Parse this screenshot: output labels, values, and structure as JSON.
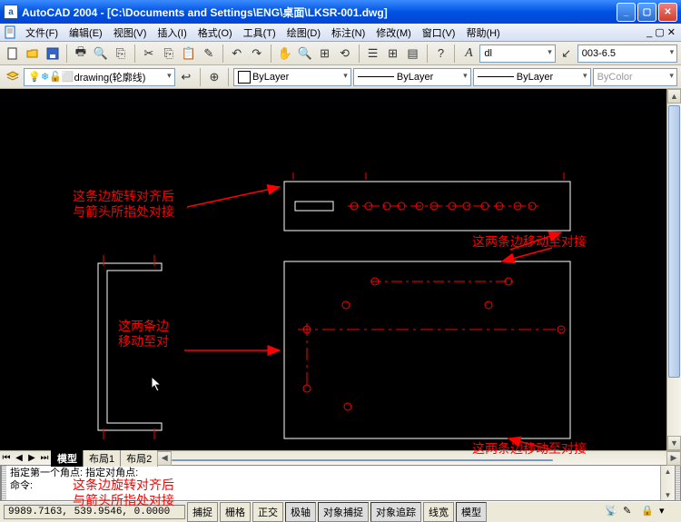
{
  "window": {
    "title": "AutoCAD 2004 - [C:\\Documents and Settings\\ENG\\桌面\\LKSR-001.dwg]",
    "app_icon_letter": "a"
  },
  "menu": {
    "items": [
      "文件(F)",
      "编辑(E)",
      "视图(V)",
      "插入(I)",
      "格式(O)",
      "工具(T)",
      "绘图(D)",
      "标注(N)",
      "修改(M)",
      "窗口(V)",
      "帮助(H)"
    ]
  },
  "toolbar1": {
    "text_style_btn": "A",
    "text_style_value": "dl",
    "dim_btn": "↙",
    "dim_style_value": "003-6.5"
  },
  "toolbar2": {
    "layer_name": "drawing(轮廓线)",
    "prop_layer1": "ByLayer",
    "prop_layer2": "ByLayer",
    "prop_layer3": "ByLayer",
    "prop_bycolor": "ByColor"
  },
  "drawing": {
    "anno1": "这条边旋转对齐后\n与箭头所指处对接",
    "anno2": "这两条边移动至对接",
    "anno3": "这两条边\n移动至对",
    "anno4": "这两条边移动至对接",
    "anno5": "这条边旋转对齐后\n与箭头所指处对接"
  },
  "tabs": {
    "model": "模型",
    "layout1": "布局1",
    "layout2": "布局2"
  },
  "command": {
    "line1": "指定第一个角点: 指定对角点:",
    "line2": "命令:"
  },
  "status": {
    "coords": "9989.7163, 539.9546, 0.0000",
    "buttons": [
      "捕捉",
      "栅格",
      "正交",
      "极轴",
      "对象捕捉",
      "对象追踪",
      "线宽",
      "模型"
    ]
  }
}
